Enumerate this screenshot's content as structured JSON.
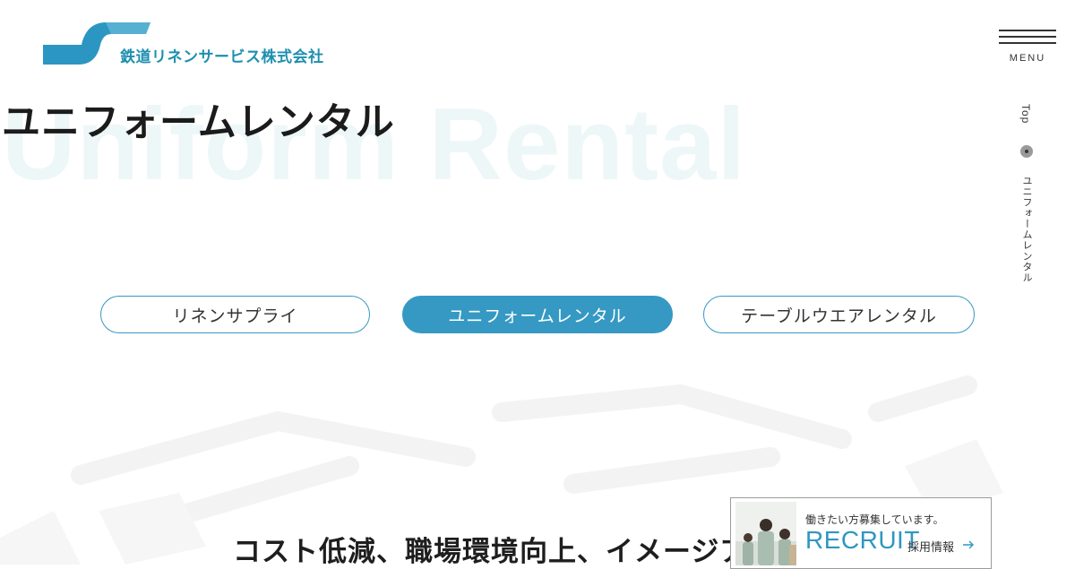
{
  "header": {
    "logo_text": "鉄道リネンサービス株式会社",
    "menu_label": "MENU"
  },
  "side_nav": {
    "top_label": "Top",
    "current_label": "ユニフォームレンタル"
  },
  "hero": {
    "bg_title": "Uniform Rental",
    "title": "ユニフォームレンタル"
  },
  "tabs": [
    {
      "label": "リネンサプライ",
      "active": false
    },
    {
      "label": "ユニフォームレンタル",
      "active": true
    },
    {
      "label": "テーブルウエアレンタル",
      "active": false
    }
  ],
  "headline": "コスト低減、職場環境向上、イメージア",
  "recruit": {
    "tagline": "働きたい方募集しています。",
    "title": "RECRUIT",
    "sub": "採用情報"
  },
  "colors": {
    "accent": "#3599c3",
    "logo": "#1e8fb0",
    "bg_title": "#eef7f8"
  }
}
